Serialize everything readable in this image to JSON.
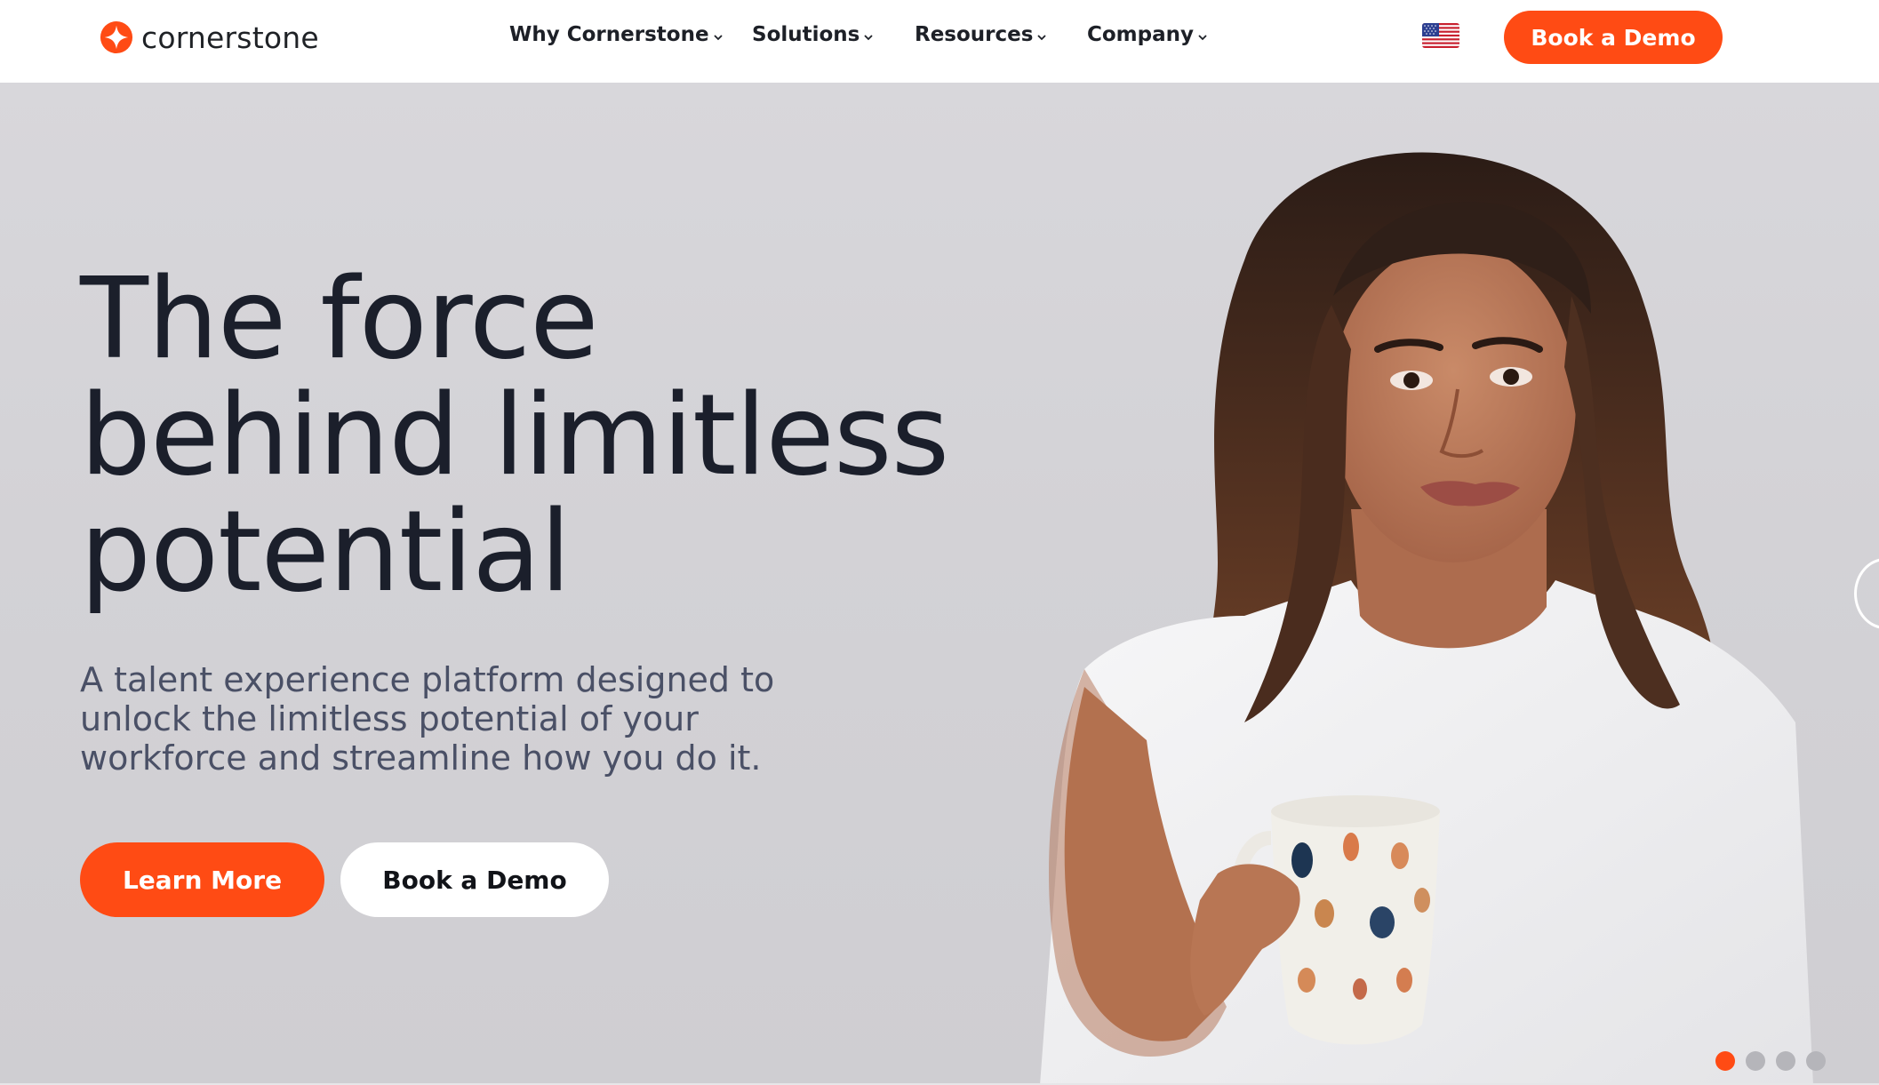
{
  "brand": {
    "name": "cornerstone",
    "accent_color": "#ff4b14",
    "logo_icon": "cornerstone-sparkle-logo-icon"
  },
  "nav": {
    "items": [
      {
        "label": "Why Cornerstone",
        "icon": "chevron-down-icon"
      },
      {
        "label": "Solutions",
        "icon": "chevron-down-icon"
      },
      {
        "label": "Resources",
        "icon": "chevron-down-icon"
      },
      {
        "label": "Company",
        "icon": "chevron-down-icon"
      }
    ],
    "locale_icon": "us-flag-icon",
    "cta_label": "Book a Demo"
  },
  "hero": {
    "headline": [
      "The force",
      "behind limitless",
      "potential"
    ],
    "subtext": "A talent experience platform designed to unlock the limitless potential of your workforce and streamline how you do it.",
    "primary_button": "Learn More",
    "secondary_button": "Book a Demo",
    "carousel": {
      "slide_count": 4,
      "active_index": 0,
      "next_icon": "arrow-right-icon"
    }
  }
}
